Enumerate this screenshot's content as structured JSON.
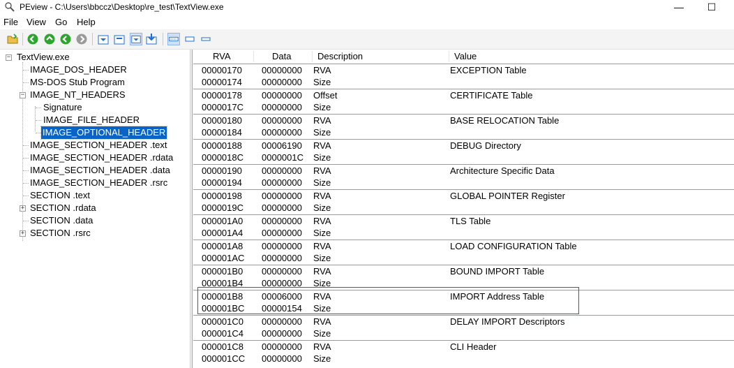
{
  "window": {
    "title": "PEview - C:\\Users\\bbccz\\Desktop\\re_test\\TextView.exe",
    "minimize": "—",
    "maximize": "☐"
  },
  "menu": [
    "File",
    "View",
    "Go",
    "Help"
  ],
  "toolbar": [
    "open-icon",
    "back-icon",
    "forward-icon",
    "previous-icon",
    "next-icon",
    "collapse-icon",
    "expand-icon",
    "view-details-icon",
    "view-bytes-icon",
    "view-hex-icon",
    "view-text-icon"
  ],
  "tree": [
    {
      "label": "TextView.exe",
      "level": 0,
      "expander": "−"
    },
    {
      "label": "IMAGE_DOS_HEADER",
      "level": 1
    },
    {
      "label": "MS-DOS Stub Program",
      "level": 1
    },
    {
      "label": "IMAGE_NT_HEADERS",
      "level": 1,
      "expander": "−"
    },
    {
      "label": "Signature",
      "level": 2
    },
    {
      "label": "IMAGE_FILE_HEADER",
      "level": 2
    },
    {
      "label": "IMAGE_OPTIONAL_HEADER",
      "level": 2,
      "selected": true
    },
    {
      "label": "IMAGE_SECTION_HEADER .text",
      "level": 1
    },
    {
      "label": "IMAGE_SECTION_HEADER .rdata",
      "level": 1
    },
    {
      "label": "IMAGE_SECTION_HEADER .data",
      "level": 1
    },
    {
      "label": "IMAGE_SECTION_HEADER .rsrc",
      "level": 1
    },
    {
      "label": "SECTION .text",
      "level": 1
    },
    {
      "label": "SECTION .rdata",
      "level": 1,
      "expander": "+"
    },
    {
      "label": "SECTION .data",
      "level": 1
    },
    {
      "label": "SECTION .rsrc",
      "level": 1,
      "expander": "+"
    }
  ],
  "columns": {
    "rva": "RVA",
    "data": "Data",
    "description": "Description",
    "value": "Value"
  },
  "rows": [
    {
      "rva": "00000170",
      "data": "00000000",
      "desc": "RVA",
      "value": "EXCEPTION Table"
    },
    {
      "rva": "00000174",
      "data": "00000000",
      "desc": "Size",
      "value": ""
    },
    {
      "rva": "00000178",
      "data": "00000000",
      "desc": "Offset",
      "value": "CERTIFICATE Table"
    },
    {
      "rva": "0000017C",
      "data": "00000000",
      "desc": "Size",
      "value": ""
    },
    {
      "rva": "00000180",
      "data": "00000000",
      "desc": "RVA",
      "value": "BASE RELOCATION Table"
    },
    {
      "rva": "00000184",
      "data": "00000000",
      "desc": "Size",
      "value": ""
    },
    {
      "rva": "00000188",
      "data": "00006190",
      "desc": "RVA",
      "value": "DEBUG Directory"
    },
    {
      "rva": "0000018C",
      "data": "0000001C",
      "desc": "Size",
      "value": ""
    },
    {
      "rva": "00000190",
      "data": "00000000",
      "desc": "RVA",
      "value": "Architecture Specific Data"
    },
    {
      "rva": "00000194",
      "data": "00000000",
      "desc": "Size",
      "value": ""
    },
    {
      "rva": "00000198",
      "data": "00000000",
      "desc": "RVA",
      "value": "GLOBAL POINTER Register"
    },
    {
      "rva": "0000019C",
      "data": "00000000",
      "desc": "Size",
      "value": ""
    },
    {
      "rva": "000001A0",
      "data": "00000000",
      "desc": "RVA",
      "value": "TLS Table"
    },
    {
      "rva": "000001A4",
      "data": "00000000",
      "desc": "Size",
      "value": ""
    },
    {
      "rva": "000001A8",
      "data": "00000000",
      "desc": "RVA",
      "value": "LOAD CONFIGURATION Table"
    },
    {
      "rva": "000001AC",
      "data": "00000000",
      "desc": "Size",
      "value": ""
    },
    {
      "rva": "000001B0",
      "data": "00000000",
      "desc": "RVA",
      "value": "BOUND IMPORT Table"
    },
    {
      "rva": "000001B4",
      "data": "00000000",
      "desc": "Size",
      "value": ""
    },
    {
      "rva": "000001B8",
      "data": "00006000",
      "desc": "RVA",
      "value": "IMPORT Address Table"
    },
    {
      "rva": "000001BC",
      "data": "00000154",
      "desc": "Size",
      "value": ""
    },
    {
      "rva": "000001C0",
      "data": "00000000",
      "desc": "RVA",
      "value": "DELAY IMPORT Descriptors"
    },
    {
      "rva": "000001C4",
      "data": "00000000",
      "desc": "Size",
      "value": ""
    },
    {
      "rva": "000001C8",
      "data": "00000000",
      "desc": "RVA",
      "value": "CLI Header"
    },
    {
      "rva": "000001CC",
      "data": "00000000",
      "desc": "Size",
      "value": ""
    }
  ],
  "colors": {
    "selection": "#0a64c8",
    "highlight_box": "#e02020",
    "toolbar_green": "#2ea52e",
    "toolbar_blue": "#1e6fd0"
  }
}
